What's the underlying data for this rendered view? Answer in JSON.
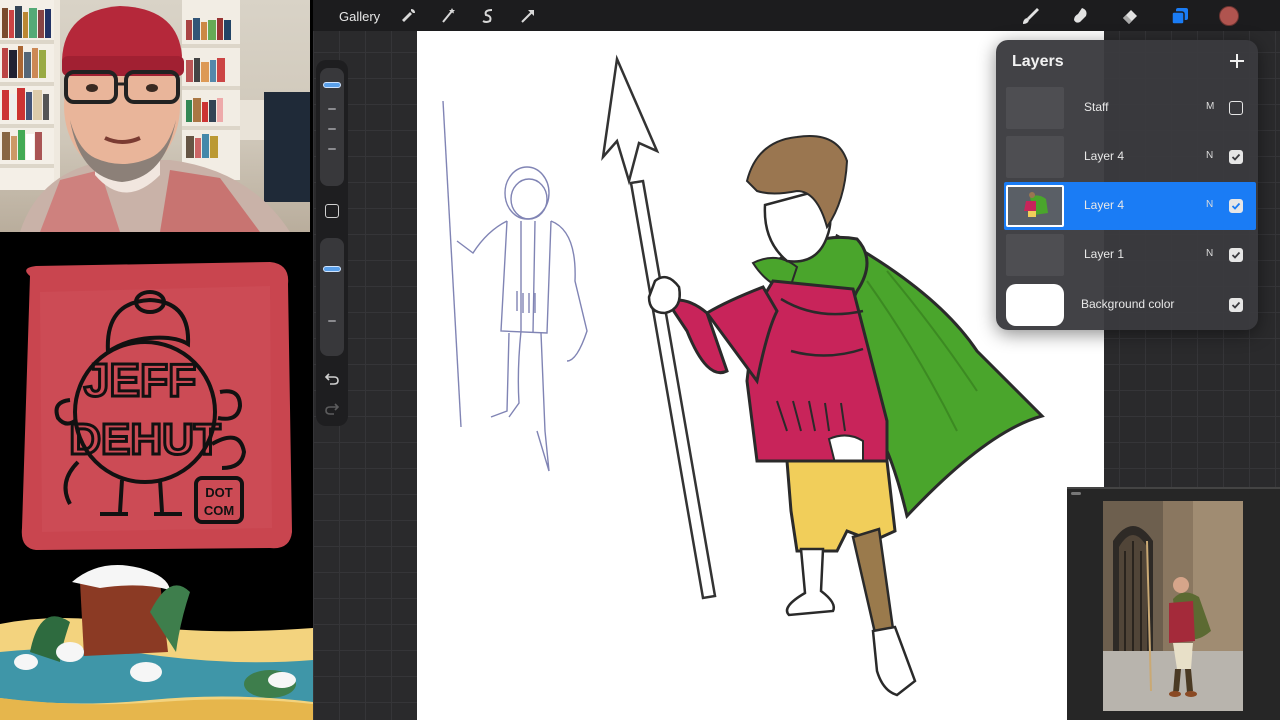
{
  "toolbar": {
    "gallery_label": "Gallery",
    "left_tools": [
      "wrench-icon",
      "magic-wand-icon",
      "selection-icon",
      "transform-arrow-icon"
    ],
    "right_tools": [
      "brush-icon",
      "smudge-icon",
      "eraser-icon",
      "layers-icon",
      "color-swatch"
    ],
    "current_color": "#b0544f"
  },
  "logo": {
    "line1": "JEFF",
    "line2": "DEHUT",
    "badge_line1": "DOT",
    "badge_line2": "COM",
    "background_color": "#c9454f"
  },
  "layers_panel": {
    "title": "Layers",
    "layers": [
      {
        "name": "Staff",
        "mode": "M",
        "visible": false,
        "active": false
      },
      {
        "name": "Layer 4",
        "mode": "N",
        "visible": true,
        "active": false
      },
      {
        "name": "Layer 4",
        "mode": "N",
        "visible": true,
        "active": true
      },
      {
        "name": "Layer 1",
        "mode": "N",
        "visible": true,
        "active": false
      }
    ],
    "background": {
      "name": "Background color",
      "visible": true,
      "color": "#ffffff"
    }
  },
  "colors": {
    "accent": "#1a7cf5",
    "tunic": "#c8245a",
    "cape": "#4aa52c",
    "trousers": "#f1ce5a",
    "hair": "#9a7650"
  }
}
